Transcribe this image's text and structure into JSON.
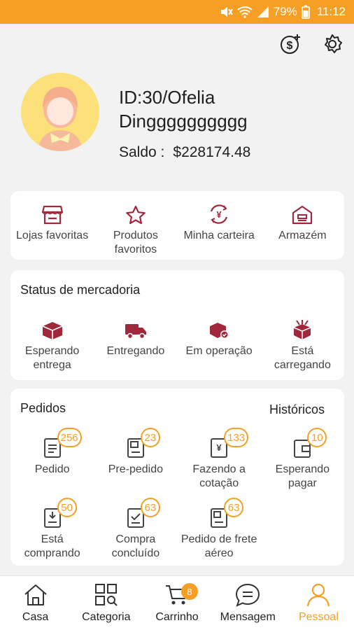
{
  "status_bar": {
    "battery": "79%",
    "time": "11:12"
  },
  "profile": {
    "id_name": "ID:30/Ofelia Dingggggggggg",
    "balance_label": "Saldo :",
    "balance_value": "$228174.48"
  },
  "shortcuts": [
    {
      "label": "Lojas favoritas",
      "icon": "store-icon"
    },
    {
      "label": "Produtos favoritos",
      "icon": "star-icon"
    },
    {
      "label": "Minha carteira",
      "icon": "yen-exchange-icon"
    },
    {
      "label": "Armazém",
      "icon": "warehouse-icon"
    }
  ],
  "goods_status": {
    "title": "Status de mercadoria",
    "items": [
      {
        "label": "Esperando entrega",
        "icon": "box-icon"
      },
      {
        "label": "Entregando",
        "icon": "truck-icon"
      },
      {
        "label": "Em operação",
        "icon": "processing-icon"
      },
      {
        "label": "Está carregando",
        "icon": "loading-box-icon"
      }
    ]
  },
  "orders": {
    "title": "Pedidos",
    "history_label": "Históricos",
    "items": [
      {
        "label": "Pedido",
        "badge": "256",
        "icon": "order-doc-icon"
      },
      {
        "label": "Pre-pedido",
        "badge": "23",
        "icon": "preorder-doc-icon"
      },
      {
        "label": "Fazendo a cotação",
        "badge": "133",
        "icon": "quote-doc-icon"
      },
      {
        "label": "Esperando pagar",
        "badge": "10",
        "icon": "wallet-icon"
      },
      {
        "label": "Está comprando",
        "badge": "50",
        "icon": "buying-doc-icon"
      },
      {
        "label": "Compra concluído",
        "badge": "63",
        "icon": "done-doc-icon"
      },
      {
        "label": "Pedido de frete aéreo",
        "badge": "63",
        "icon": "air-freight-doc-icon"
      }
    ]
  },
  "bottom_nav": [
    {
      "label": "Casa",
      "icon": "home-icon"
    },
    {
      "label": "Categoria",
      "icon": "category-icon"
    },
    {
      "label": "Carrinho",
      "icon": "cart-icon",
      "badge": "8"
    },
    {
      "label": "Mensagem",
      "icon": "message-icon"
    },
    {
      "label": "Pessoal",
      "icon": "person-icon",
      "active": true
    }
  ],
  "colors": {
    "accent": "#f5a025",
    "icon_red": "#a0283c"
  }
}
